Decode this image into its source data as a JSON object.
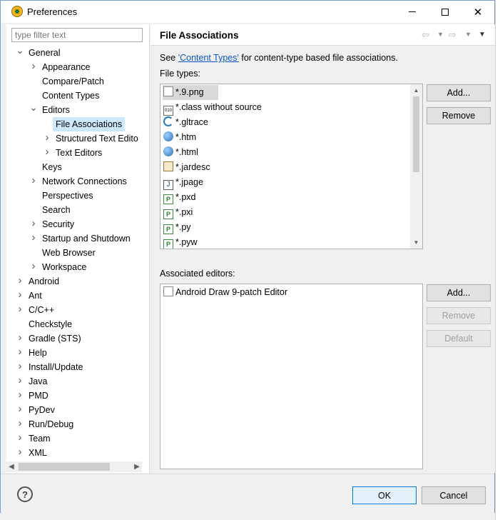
{
  "window": {
    "title": "Preferences"
  },
  "filter": {
    "placeholder": "type filter text"
  },
  "tree": [
    {
      "label": "General",
      "level": 0,
      "expanded": true
    },
    {
      "label": "Appearance",
      "level": 1,
      "expanded": false
    },
    {
      "label": "Compare/Patch",
      "level": 1
    },
    {
      "label": "Content Types",
      "level": 1
    },
    {
      "label": "Editors",
      "level": 1,
      "expanded": true
    },
    {
      "label": "File Associations",
      "level": 2,
      "selected": true
    },
    {
      "label": "Structured Text Edito",
      "level": 2,
      "expanded": false
    },
    {
      "label": "Text Editors",
      "level": 2,
      "expanded": false
    },
    {
      "label": "Keys",
      "level": 1
    },
    {
      "label": "Network Connections",
      "level": 1,
      "expanded": false
    },
    {
      "label": "Perspectives",
      "level": 1
    },
    {
      "label": "Search",
      "level": 1
    },
    {
      "label": "Security",
      "level": 1,
      "expanded": false
    },
    {
      "label": "Startup and Shutdown",
      "level": 1,
      "expanded": false
    },
    {
      "label": "Web Browser",
      "level": 1
    },
    {
      "label": "Workspace",
      "level": 1,
      "expanded": false
    },
    {
      "label": "Android",
      "level": 0,
      "expanded": false
    },
    {
      "label": "Ant",
      "level": 0,
      "expanded": false
    },
    {
      "label": "C/C++",
      "level": 0,
      "expanded": false
    },
    {
      "label": "Checkstyle",
      "level": 0
    },
    {
      "label": "Gradle (STS)",
      "level": 0,
      "expanded": false
    },
    {
      "label": "Help",
      "level": 0,
      "expanded": false
    },
    {
      "label": "Install/Update",
      "level": 0,
      "expanded": false
    },
    {
      "label": "Java",
      "level": 0,
      "expanded": false
    },
    {
      "label": "PMD",
      "level": 0,
      "expanded": false
    },
    {
      "label": "PyDev",
      "level": 0,
      "expanded": false
    },
    {
      "label": "Run/Debug",
      "level": 0,
      "expanded": false
    },
    {
      "label": "Team",
      "level": 0,
      "expanded": false
    },
    {
      "label": "XML",
      "level": 0,
      "expanded": false
    }
  ],
  "page": {
    "title": "File Associations",
    "see_prefix": "See ",
    "see_link": "'Content Types'",
    "see_suffix": " for content-type based file associations.",
    "file_types_label": "File types:",
    "associated_editors_label": "Associated editors:"
  },
  "file_types": [
    {
      "name": "*.9.png",
      "icon": "document-icon",
      "selected": true
    },
    {
      "name": "*.class without source",
      "icon": "binary-class-icon"
    },
    {
      "name": "*.gltrace",
      "icon": "gltrace-icon"
    },
    {
      "name": "*.htm",
      "icon": "globe-icon"
    },
    {
      "name": "*.html",
      "icon": "globe-icon"
    },
    {
      "name": "*.jardesc",
      "icon": "jar-icon"
    },
    {
      "name": "*.jpage",
      "icon": "java-page-icon"
    },
    {
      "name": "*.pxd",
      "icon": "python-file-icon"
    },
    {
      "name": "*.pxi",
      "icon": "python-file-icon"
    },
    {
      "name": "*.py",
      "icon": "python-file-icon"
    },
    {
      "name": "*.pyw",
      "icon": "python-file-icon"
    }
  ],
  "editors": [
    {
      "name": "Android Draw 9-patch Editor",
      "icon": "document-icon"
    }
  ],
  "buttons": {
    "file_add": "Add...",
    "file_remove": "Remove",
    "editor_add": "Add...",
    "editor_remove": "Remove",
    "editor_default": "Default",
    "ok": "OK",
    "cancel": "Cancel"
  },
  "colors": {
    "selection": "#cce8ff",
    "link": "#0a55c4",
    "ok_border": "#0078d7"
  }
}
